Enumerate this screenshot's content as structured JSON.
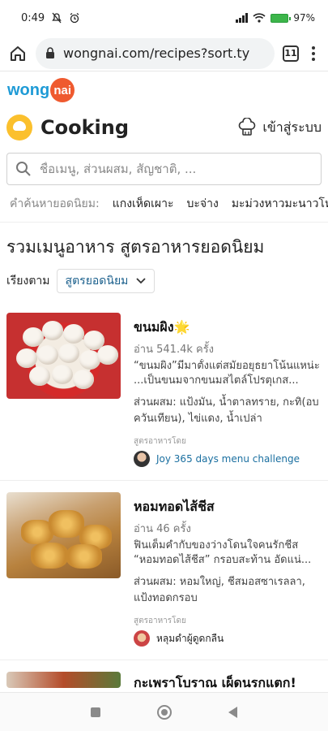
{
  "status": {
    "time": "0:49",
    "battery": "97%"
  },
  "browser": {
    "url": "wongnai.com/recipes?sort.ty",
    "tab_count": "11"
  },
  "brand": {
    "logo_left": "wong",
    "logo_right": "nai"
  },
  "header": {
    "title": "Cooking",
    "login_label": "เข้าสู่ระบบ"
  },
  "search": {
    "placeholder": "ชื่อเมนู, ส่วนผสม, สัญชาติ, ..."
  },
  "popular": {
    "label": "คำค้นหายอดนิยม:",
    "chips": [
      "แกงเห็ดเผาะ",
      "บะจ่าง",
      "มะม่วงหาวมะนาวโห่"
    ]
  },
  "main": {
    "title": "รวมเมนูอาหาร สูตรอาหารยอดนิยม",
    "sort_label": "เรียงตาม",
    "sort_value": "สูตรยอดนิยม"
  },
  "recipes": [
    {
      "title": "ขนมผิง🌟",
      "views": "อ่าน 541.4k ครั้ง",
      "desc": "“ขนมผิง”มีมาตั้งแต่สมัยอยุธยาโน้นแหน่ะ ...เป็นขนมจากขนมสไตล์โปรตุเกส...",
      "ingredients": "ส่วนผสม: แป้งมัน, น้ำตาลทราย, กะทิ(อบควันเทียน), ไข่แดง, น้ำเปล่า",
      "by_label": "สูตรอาหารโดย",
      "author": "Joy 365 days menu challenge"
    },
    {
      "title": "หอมทอดไส้ชีส",
      "views": "อ่าน 46 ครั้ง",
      "desc": "ฟินเต็มคำกับของว่างโดนใจคนรักชีส “หอมทอดไส้ชีส” กรอบสะท้าน อัดแน่...",
      "ingredients": "ส่วนผสม: หอมใหญ่, ชีสมอสซาเรลลา, แป้งทอดกรอบ",
      "by_label": "สูตรอาหารโดย",
      "author": "หลุมดำผู้ดูดกลืน"
    },
    {
      "title": "กะเพราโบราณ เผ็ดนรกแตก!"
    }
  ]
}
